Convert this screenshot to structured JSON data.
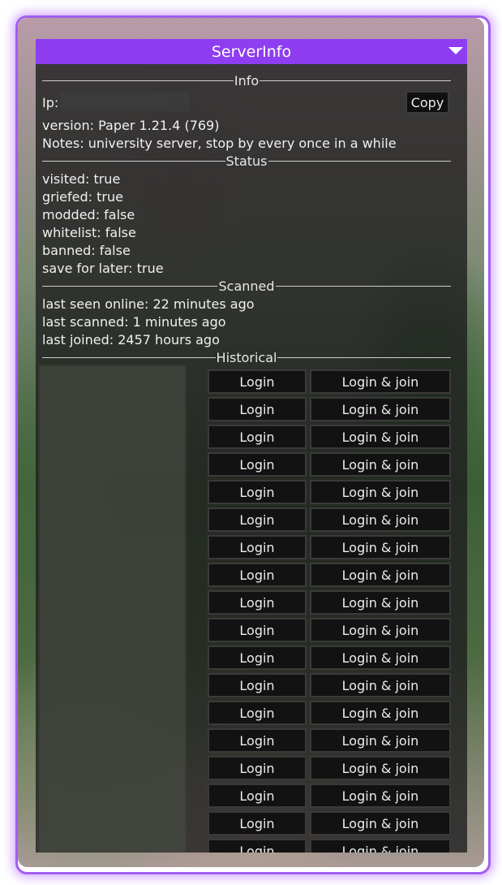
{
  "window": {
    "title": "ServerInfo"
  },
  "info": {
    "header": "Info",
    "ip_label": "Ip:",
    "copy_label": "Copy",
    "version": "version: Paper 1.21.4 (769)",
    "notes": "Notes: university server, stop by every once in a while"
  },
  "status": {
    "header": "Status",
    "lines": [
      "visited: true",
      "griefed: true",
      "modded: false",
      "whitelist: false",
      "banned: false",
      "save for later: true"
    ]
  },
  "scanned": {
    "header": "Scanned",
    "lines": [
      "last seen online: 22 minutes ago",
      "last scanned: 1 minutes ago",
      "last joined: 2457 hours ago"
    ]
  },
  "historical": {
    "header": "Historical",
    "login_label": "Login",
    "join_label": "Login & join",
    "row_count": 18
  },
  "colors": {
    "accent": "#8e3ef0",
    "frame_glow": "#a25ef0"
  }
}
